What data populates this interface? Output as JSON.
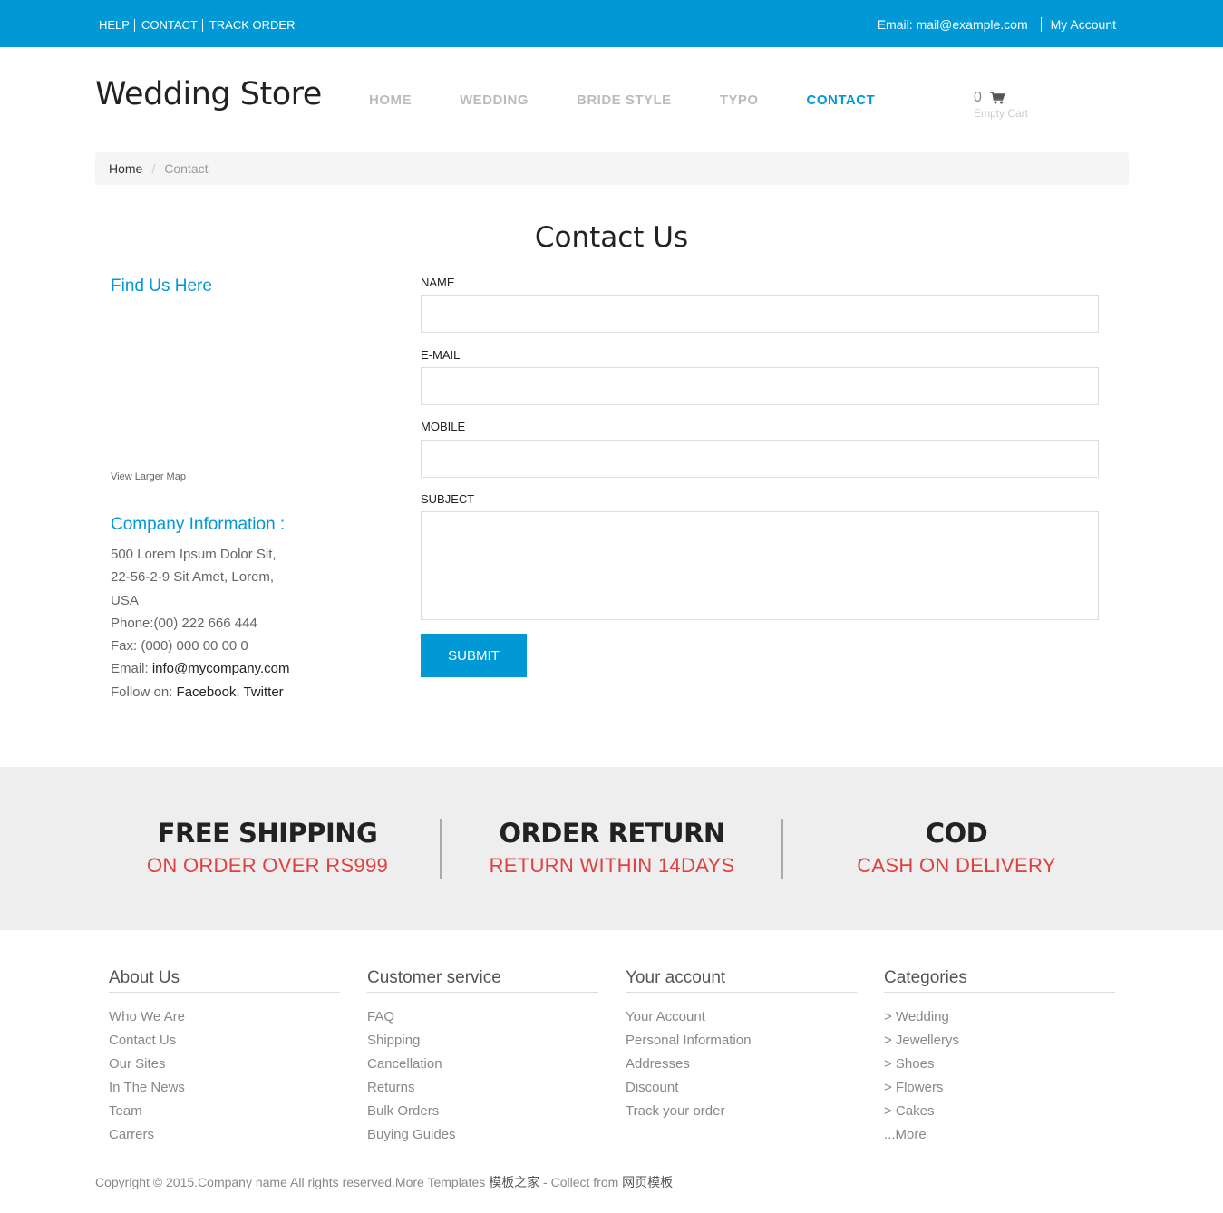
{
  "topbar": {
    "links": [
      "HELP",
      "CONTACT",
      "TRACK ORDER"
    ],
    "email": "Email: mail@example.com",
    "account": "My Account"
  },
  "header": {
    "logo": "Wedding Store",
    "nav": [
      "HOME",
      "WEDDING",
      "BRIDE STYLE",
      "TYPO",
      "CONTACT"
    ],
    "active_nav": "CONTACT",
    "cart_count": "0",
    "cart_label": "Empty Cart"
  },
  "breadcrumb": {
    "home": "Home",
    "separator": "/",
    "current": "Contact"
  },
  "contact": {
    "title": "Contact Us",
    "find_us": "Find Us Here",
    "view_map": "View Larger Map",
    "company_title": "Company Information :",
    "address_lines": [
      "500 Lorem Ipsum Dolor Sit,",
      "22-56-2-9 Sit Amet, Lorem,",
      "USA"
    ],
    "phone": "Phone:(00) 222 666 444",
    "fax": "Fax: (000) 000 00 00 0",
    "email_label": "Email: ",
    "email_value": "info@mycompany.com",
    "follow_label": "Follow on: ",
    "follow_facebook": "Facebook",
    "follow_comma": ", ",
    "follow_twitter": "Twitter"
  },
  "form": {
    "name_label": "NAME",
    "email_label": "E-MAIL",
    "mobile_label": "MOBILE",
    "subject_label": "SUBJECT",
    "name_value": "",
    "email_value": "",
    "mobile_value": "",
    "subject_value": "",
    "submit": "SUBMIT"
  },
  "features": [
    {
      "heading": "FREE SHIPPING",
      "sub": "ON ORDER OVER RS999"
    },
    {
      "heading": "ORDER RETURN",
      "sub": "RETURN WITHIN 14DAYS"
    },
    {
      "heading": "COD",
      "sub": "CASH ON DELIVERY"
    }
  ],
  "footer": {
    "columns": [
      {
        "title": "About Us",
        "items": [
          "Who We Are",
          "Contact Us",
          "Our Sites",
          "In The News",
          "Team",
          "Carrers"
        ]
      },
      {
        "title": "Customer service",
        "items": [
          "FAQ",
          "Shipping",
          "Cancellation",
          "Returns",
          "Bulk Orders",
          "Buying Guides"
        ]
      },
      {
        "title": "Your account",
        "items": [
          "Your Account",
          "Personal Information",
          "Addresses",
          "Discount",
          "Track your order"
        ]
      },
      {
        "title": "Categories",
        "items": [
          "> Wedding",
          "> Jewellerys",
          "> Shoes",
          "> Flowers",
          "> Cakes",
          "...More"
        ]
      }
    ],
    "copyright_text": "Copyright © 2015.Company name All rights reserved.More Templates ",
    "copyright_link1": "模板之家",
    "copyright_mid": " - Collect from ",
    "copyright_link2": "网页模板"
  },
  "colors": {
    "accent": "#0099d6",
    "feature_sub": "#e04040",
    "band": "#eeeeee"
  },
  "icons": [
    "cart-icon"
  ]
}
